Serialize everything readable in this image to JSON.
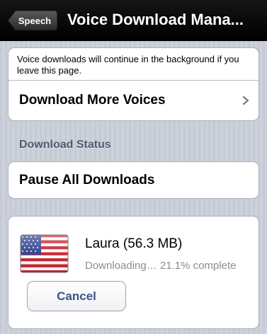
{
  "navbar": {
    "back_label": "Speech",
    "title": "Voice Download Mana..."
  },
  "info": {
    "text": "Voice downloads will continue in the background if you leave this page."
  },
  "download_more": {
    "label": "Download More Voices",
    "chevron_icon": "chevron-right-icon"
  },
  "status_section": {
    "header": "Download Status",
    "pause_label": "Pause All Downloads"
  },
  "voice_item": {
    "flag_icon": "us-flag-icon",
    "name": "Laura (56.3 MB)",
    "status": "Downloading… 21.1% complete",
    "progress_percent": 21.1,
    "cancel_label": "Cancel"
  },
  "colors": {
    "navbar_bg": "#000000",
    "background": "#c7ccd6",
    "section_header": "#4d5a73",
    "button_text": "#3a5486",
    "status_text": "#8a8d93"
  }
}
